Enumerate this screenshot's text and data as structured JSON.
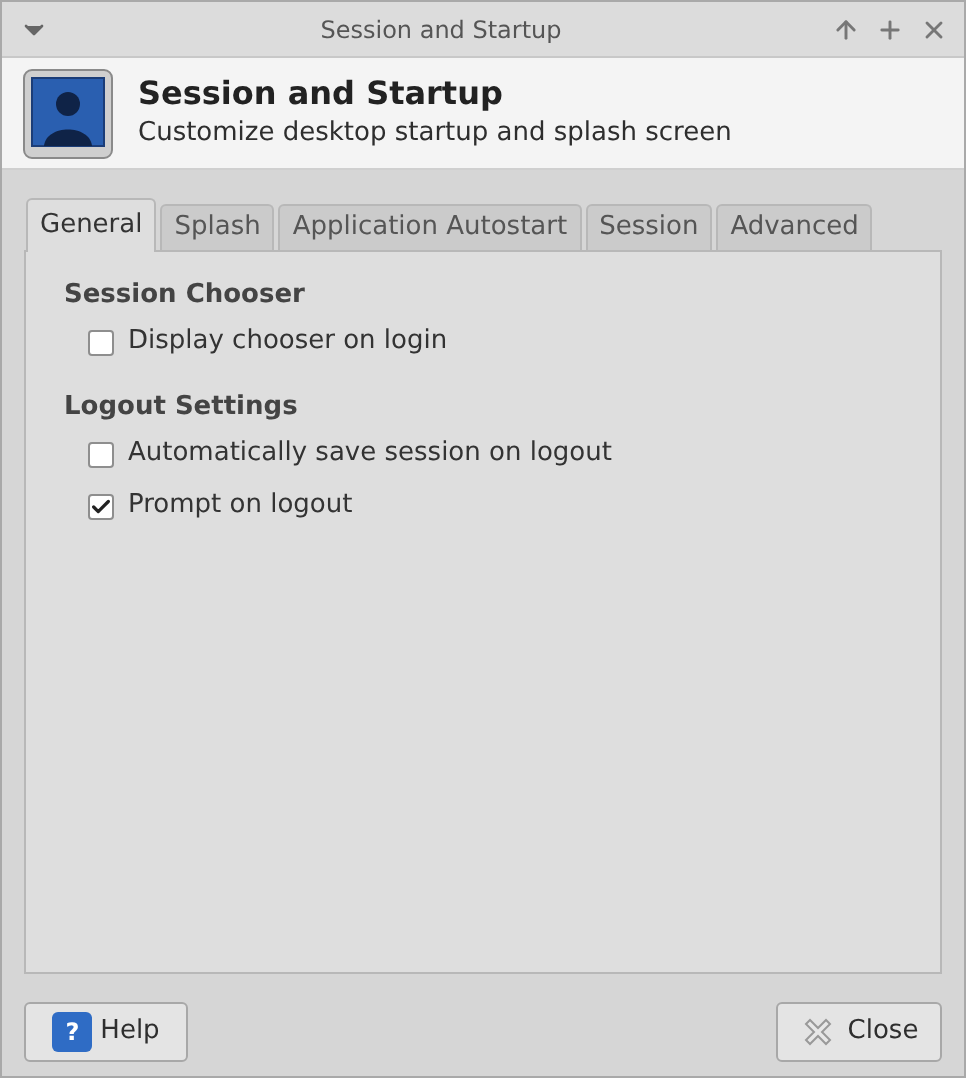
{
  "window": {
    "title": "Session and Startup"
  },
  "header": {
    "title": "Session and Startup",
    "subtitle": "Customize desktop startup and splash screen"
  },
  "tabs": [
    {
      "label": "General",
      "selected": true
    },
    {
      "label": "Splash",
      "selected": false
    },
    {
      "label": "Application Autostart",
      "selected": false
    },
    {
      "label": "Session",
      "selected": false
    },
    {
      "label": "Advanced",
      "selected": false
    }
  ],
  "sections": [
    {
      "title": "Session Chooser",
      "options": [
        {
          "label": "Display chooser on login",
          "checked": false
        }
      ]
    },
    {
      "title": "Logout Settings",
      "options": [
        {
          "label": "Automatically save session on logout",
          "checked": false
        },
        {
          "label": "Prompt on logout",
          "checked": true
        }
      ]
    }
  ],
  "buttons": {
    "help": {
      "icon_glyph": "?",
      "label": "Help"
    },
    "close": {
      "label": "Close"
    }
  }
}
